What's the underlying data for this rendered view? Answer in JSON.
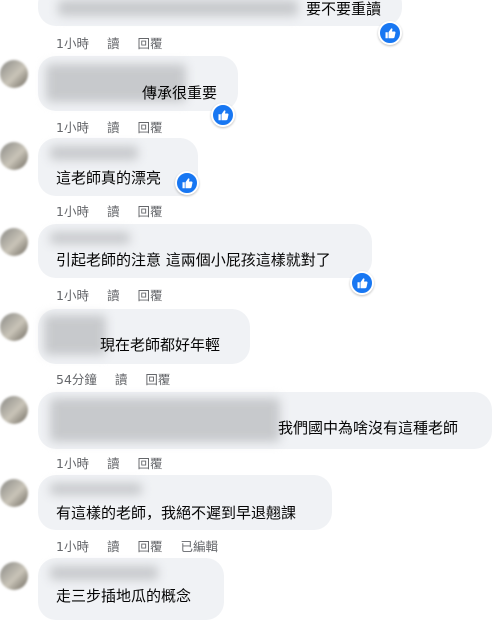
{
  "comments": [
    {
      "text": "要不要重讀",
      "time": "1小時",
      "read": "讀",
      "reply": "回覆",
      "reactions": "like-icon"
    },
    {
      "text": "傳承很重要",
      "time": "1小時",
      "read": "讀",
      "reply": "回覆",
      "reactions": "like-icon"
    },
    {
      "text": "這老師真的漂亮",
      "time": "1小時",
      "read": "讀",
      "reply": "回覆",
      "reactions": "like-icon"
    },
    {
      "text": "引起老師的注意 這兩個小屁孩這樣就對了",
      "time": "1小時",
      "read": "讀",
      "reply": "回覆",
      "reactions": "like-icon"
    },
    {
      "text": "現在老師都好年輕",
      "time": "54分鐘",
      "read": "讀",
      "reply": "回覆"
    },
    {
      "text": "我們國中為啥沒有這種老師",
      "time": "1小時",
      "read": "讀",
      "reply": "回覆"
    },
    {
      "text": "有這樣的老師，我絕不遲到早退翹課",
      "time": "1小時",
      "read": "讀",
      "reply": "回覆",
      "edited": "已編輯"
    },
    {
      "text": "走三步插地瓜的概念"
    }
  ],
  "colors": {
    "bubble": "#f0f2f5",
    "meta": "#65676b",
    "like": "#1877f2"
  }
}
